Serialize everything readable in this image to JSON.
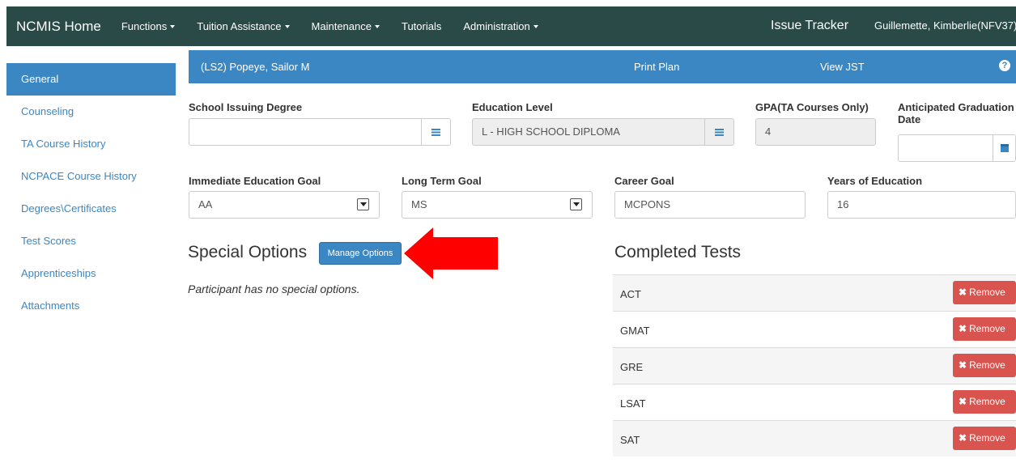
{
  "nav": {
    "brand": "NCMIS Home",
    "items": [
      {
        "label": "Functions",
        "dropdown": true
      },
      {
        "label": "Tuition Assistance",
        "dropdown": true
      },
      {
        "label": "Maintenance",
        "dropdown": true
      },
      {
        "label": "Tutorials",
        "dropdown": false
      },
      {
        "label": "Administration",
        "dropdown": true
      }
    ],
    "issue_tracker": "Issue Tracker",
    "user": "Guillemette, Kimberlie(NFV37)"
  },
  "sidebar": {
    "items": [
      {
        "label": "General",
        "active": true
      },
      {
        "label": "Counseling"
      },
      {
        "label": "TA Course History"
      },
      {
        "label": "NCPACE Course History"
      },
      {
        "label": "Degrees\\Certificates"
      },
      {
        "label": "Test Scores"
      },
      {
        "label": "Apprenticeships"
      },
      {
        "label": "Attachments"
      }
    ]
  },
  "header": {
    "participant": "(LS2) Popeye, Sailor M",
    "print_plan": "Print Plan",
    "view_jst": "View JST",
    "help_icon": "?"
  },
  "form": {
    "school_issuing_degree": {
      "label": "School Issuing Degree",
      "value": ""
    },
    "education_level": {
      "label": "Education Level",
      "value": "L - HIGH SCHOOL DIPLOMA"
    },
    "gpa": {
      "label": "GPA(TA Courses Only)",
      "value": "4"
    },
    "anticipated_graduation": {
      "label_line1": "Anticipated Graduation",
      "label_line2": "Date",
      "value": ""
    },
    "immediate_goal": {
      "label": "Immediate Education Goal",
      "value": "AA"
    },
    "long_term_goal": {
      "label": "Long Term Goal",
      "value": "MS"
    },
    "career_goal": {
      "label": "Career Goal",
      "value": "MCPONS"
    },
    "years_education": {
      "label": "Years of Education",
      "value": "16"
    }
  },
  "special_options": {
    "title": "Special Options",
    "manage_button": "Manage Options",
    "empty_text": "Participant has no special options."
  },
  "completed_tests": {
    "title": "Completed Tests",
    "remove_label": "Remove",
    "remove_icon": "✖",
    "tests": [
      "ACT",
      "GMAT",
      "GRE",
      "LSAT",
      "SAT"
    ]
  },
  "colors": {
    "navbar": "#294a46",
    "primary": "#3a87c4",
    "danger": "#d9534f",
    "annotation_arrow": "#ff0000"
  }
}
